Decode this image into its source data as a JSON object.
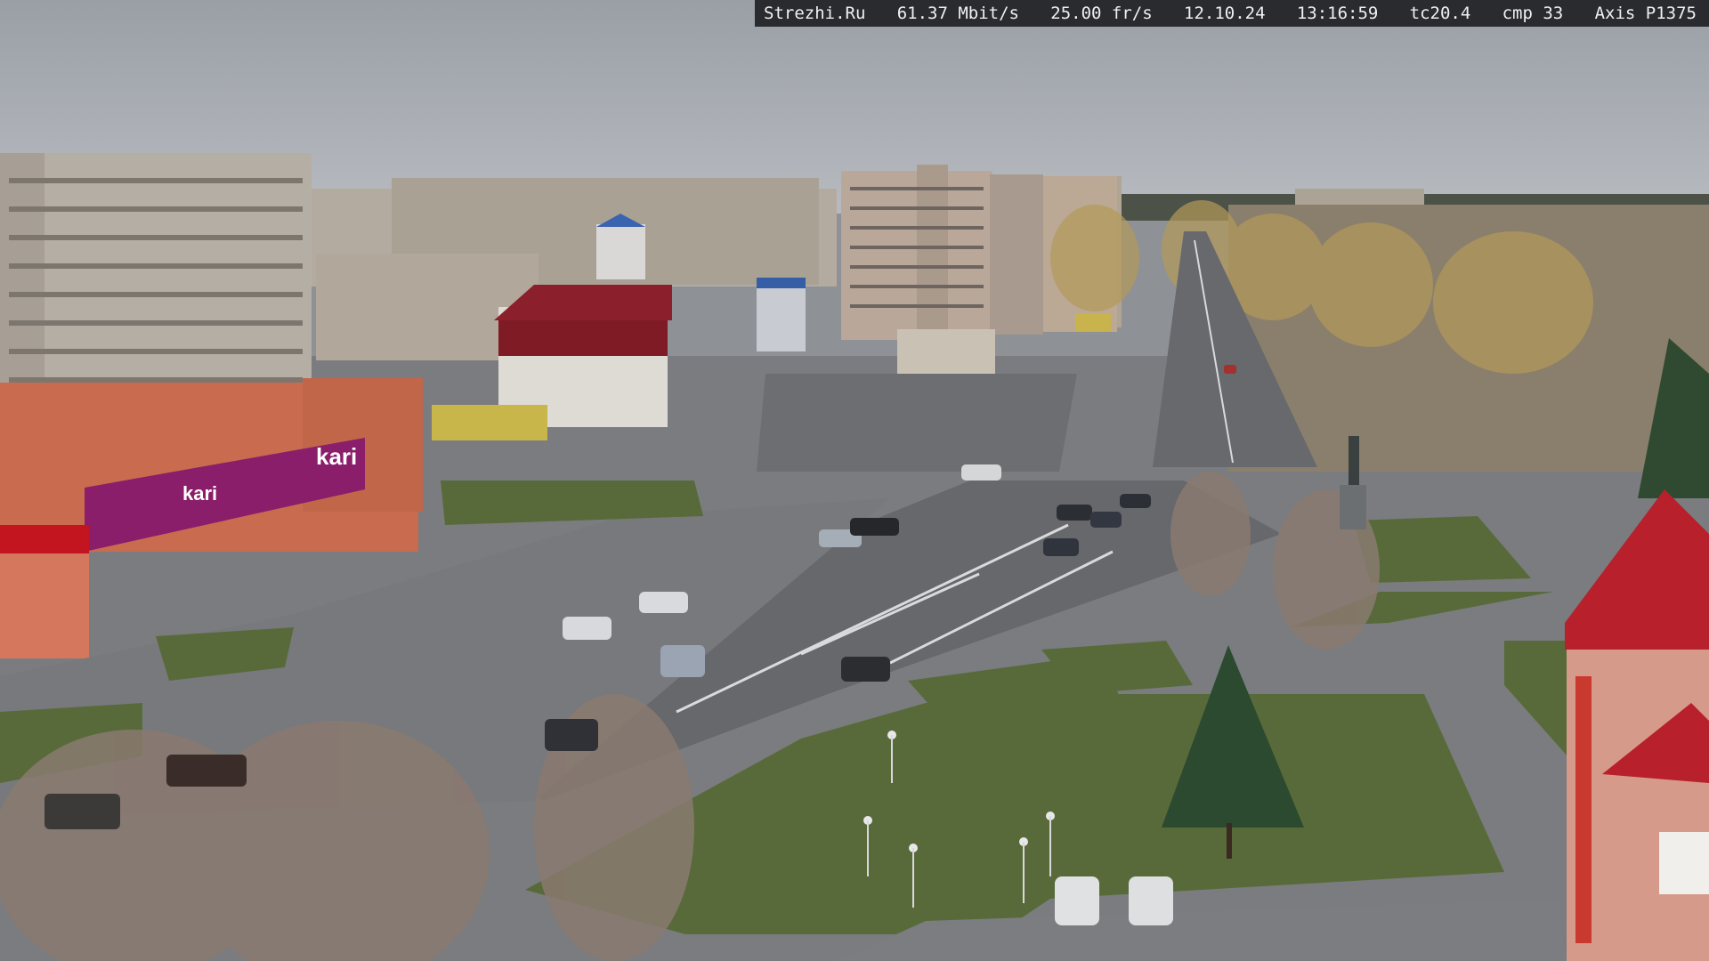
{
  "overlay": {
    "site": "Strezhi.Ru",
    "bitrate": "61.37 Mbit/s",
    "framerate": "25.00 fr/s",
    "date": "12.10.24",
    "time": "13:16:59",
    "tc": "tc20.4",
    "cmp": "cmp 33",
    "camera_model": "Axis P1375"
  },
  "signage": {
    "store_name": "kari",
    "store_name_side": "kari"
  },
  "colors": {
    "sky": "#a7acb2",
    "asphalt": "#6f7175",
    "grass": "#5b6a3e",
    "kari_magenta": "#8a1e6a",
    "brick": "#c86a4e",
    "roof_red": "#b8202c"
  }
}
